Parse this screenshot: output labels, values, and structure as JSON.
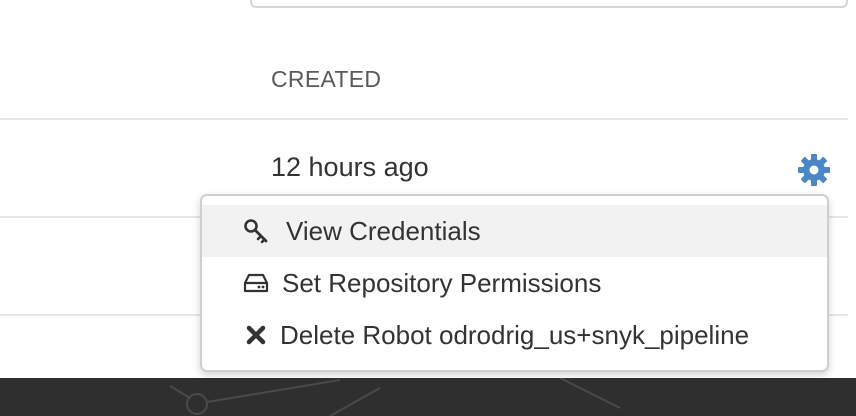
{
  "table": {
    "column_header": "CREATED",
    "row": {
      "created": "12 hours ago"
    }
  },
  "menu": {
    "items": [
      {
        "label": "View Credentials",
        "icon": "key-icon"
      },
      {
        "label": "Set Repository Permissions",
        "icon": "hdd-icon"
      },
      {
        "label": "Delete Robot odrodrig_us+snyk_pipeline",
        "icon": "close-icon"
      }
    ]
  },
  "colors": {
    "gear_accent": "#4a87c7",
    "footer_bg": "#2f2f2f",
    "menu_hover_bg": "#f2f2f2"
  }
}
